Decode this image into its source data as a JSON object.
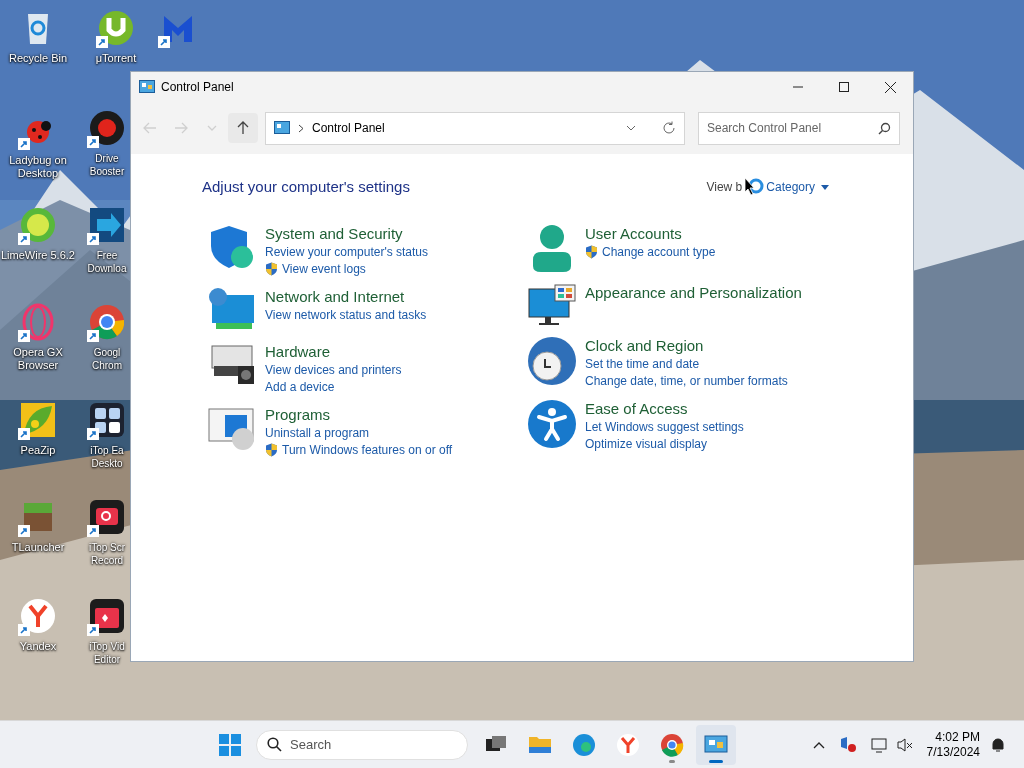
{
  "desktop_icons": [
    {
      "kind": "recycle",
      "label": "Recycle Bin",
      "shortcut": false
    },
    {
      "kind": "ladybug",
      "label": "Ladybug on Desktop",
      "shortcut": true
    },
    {
      "kind": "limewire",
      "label": "LimeWire 5.6.2",
      "shortcut": true
    },
    {
      "kind": "opera",
      "label": "Opera GX Browser",
      "shortcut": true
    },
    {
      "kind": "peazip",
      "label": "PeaZip",
      "shortcut": true
    },
    {
      "kind": "tlauncher",
      "label": "TLauncher",
      "shortcut": true
    },
    {
      "kind": "yandex",
      "label": "Yandex",
      "shortcut": true
    },
    {
      "kind": "utorrent",
      "label": "μTorrent",
      "shortcut": true
    },
    {
      "kind": "booster",
      "label": "Drive Booster",
      "shortcut": true
    },
    {
      "kind": "download",
      "label": "Free Downloa",
      "shortcut": true
    },
    {
      "kind": "chrome",
      "label": "Googl Chrom",
      "shortcut": true
    },
    {
      "kind": "itop-desktop",
      "label": "iTop Ea Deskto",
      "shortcut": true
    },
    {
      "kind": "itop-recorder",
      "label": "iTop Scr Record",
      "shortcut": true
    },
    {
      "kind": "itop-video",
      "label": "iTop Vid Editor",
      "shortcut": true
    },
    {
      "kind": "malwarebytes",
      "shortcut": true
    }
  ],
  "window": {
    "title": "Control Panel",
    "nav": [
      {
        "kind": "back",
        "disabled": true
      },
      {
        "kind": "forward",
        "disabled": true
      },
      {
        "kind": "recent",
        "disabled": true
      },
      {
        "kind": "up",
        "disabled": false
      }
    ],
    "address": "Control Panel",
    "search": {
      "placeholder": "Search Control Panel"
    },
    "heading": "Adjust your computer's settings",
    "view_by": {
      "label": "View b",
      "value": "Category"
    },
    "categories": [
      [
        {
          "kind": "security",
          "title": "System and Security",
          "links": [
            {
              "text": "Review your computer's status",
              "shield": false
            },
            {
              "text": "View event logs",
              "shield": true
            }
          ]
        },
        {
          "kind": "network",
          "title": "Network and Internet",
          "links": [
            {
              "text": "View network status and tasks",
              "shield": false
            }
          ]
        },
        {
          "kind": "hardware",
          "title": "Hardware",
          "links": [
            {
              "text": "View devices and printers",
              "shield": false
            },
            {
              "text": "Add a device",
              "shield": false
            }
          ]
        },
        {
          "kind": "programs",
          "title": "Programs",
          "links": [
            {
              "text": "Uninstall a program",
              "shield": false
            },
            {
              "text": "Turn Windows features on or off",
              "shield": true
            }
          ]
        }
      ],
      [
        {
          "kind": "user",
          "title": "User Accounts",
          "links": [
            {
              "text": "Change account type",
              "shield": true
            }
          ]
        },
        {
          "kind": "appearance",
          "title": "Appearance and Personalization"
        },
        {
          "kind": "clock",
          "title": "Clock and Region",
          "links": [
            {
              "text": "Set the time and date",
              "shield": false
            },
            {
              "text": "Change date, time, or number formats",
              "shield": false
            }
          ]
        },
        {
          "kind": "access",
          "title": "Ease of Access",
          "links": [
            {
              "text": "Let Windows suggest settings",
              "shield": false
            },
            {
              "text": "Optimize visual display",
              "shield": false
            }
          ]
        }
      ]
    ]
  },
  "taskbar": {
    "search_placeholder": "Search",
    "apps": [
      {
        "kind": "taskview",
        "running": false,
        "selected": false
      },
      {
        "kind": "explorer",
        "running": false,
        "selected": false
      },
      {
        "kind": "edge",
        "running": false,
        "selected": false
      },
      {
        "kind": "yandex",
        "running": false,
        "selected": false
      },
      {
        "kind": "chrome",
        "running": true,
        "selected": false
      },
      {
        "kind": "controlpanel",
        "running": true,
        "selected": true
      }
    ],
    "time": "4:02 PM",
    "date": "7/13/2024"
  }
}
